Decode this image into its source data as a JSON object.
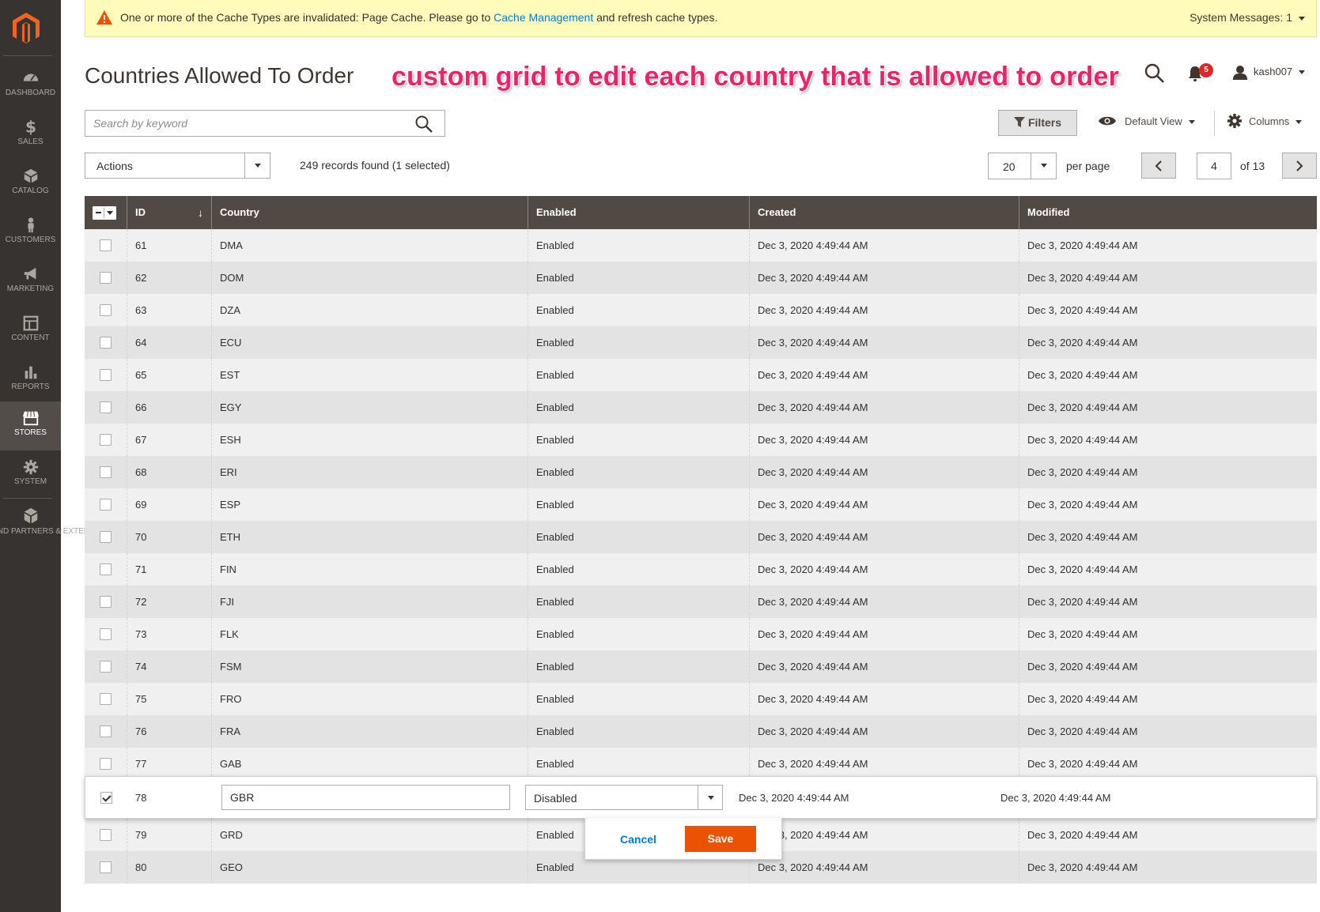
{
  "sidebar": {
    "items": [
      {
        "label": "DASHBOARD",
        "icon": "dashboard-icon"
      },
      {
        "label": "SALES",
        "icon": "dollar-icon"
      },
      {
        "label": "CATALOG",
        "icon": "cube-icon"
      },
      {
        "label": "CUSTOMERS",
        "icon": "person-icon"
      },
      {
        "label": "MARKETING",
        "icon": "megaphone-icon"
      },
      {
        "label": "CONTENT",
        "icon": "layout-icon"
      },
      {
        "label": "REPORTS",
        "icon": "bar-chart-icon"
      },
      {
        "label": "STORES",
        "icon": "storefront-icon"
      },
      {
        "label": "SYSTEM",
        "icon": "gear-icon"
      },
      {
        "label": "IND PARTNERS & EXTENSIONS",
        "icon": "blocks-icon"
      }
    ],
    "active": "STORES"
  },
  "system_message": {
    "text_before": "One or more of the Cache Types are invalidated: Page Cache. Please go to ",
    "link": "Cache Management",
    "text_after": " and refresh cache types.",
    "right_label": "System Messages: 1"
  },
  "header": {
    "title": "Countries Allowed To Order",
    "annotation": "custom grid to edit each country that is allowed to order",
    "notification_count": "5",
    "username": "kash007"
  },
  "toolbar": {
    "search_placeholder": "Search by keyword",
    "filters_label": "Filters",
    "view_label": "Default View",
    "columns_label": "Columns",
    "actions_label": "Actions",
    "records_text": "249 records found (1 selected)",
    "per_page_value": "20",
    "per_page_label": "per page",
    "current_page": "4",
    "page_total": "of 13"
  },
  "grid": {
    "columns": [
      "ID",
      "Country",
      "Enabled",
      "Created",
      "Modified"
    ],
    "rows": [
      {
        "id": "61",
        "country": "DMA",
        "enabled": "Enabled",
        "created": "Dec 3, 2020 4:49:44 AM",
        "modified": "Dec 3, 2020 4:49:44 AM"
      },
      {
        "id": "62",
        "country": "DOM",
        "enabled": "Enabled",
        "created": "Dec 3, 2020 4:49:44 AM",
        "modified": "Dec 3, 2020 4:49:44 AM"
      },
      {
        "id": "63",
        "country": "DZA",
        "enabled": "Enabled",
        "created": "Dec 3, 2020 4:49:44 AM",
        "modified": "Dec 3, 2020 4:49:44 AM"
      },
      {
        "id": "64",
        "country": "ECU",
        "enabled": "Enabled",
        "created": "Dec 3, 2020 4:49:44 AM",
        "modified": "Dec 3, 2020 4:49:44 AM"
      },
      {
        "id": "65",
        "country": "EST",
        "enabled": "Enabled",
        "created": "Dec 3, 2020 4:49:44 AM",
        "modified": "Dec 3, 2020 4:49:44 AM"
      },
      {
        "id": "66",
        "country": "EGY",
        "enabled": "Enabled",
        "created": "Dec 3, 2020 4:49:44 AM",
        "modified": "Dec 3, 2020 4:49:44 AM"
      },
      {
        "id": "67",
        "country": "ESH",
        "enabled": "Enabled",
        "created": "Dec 3, 2020 4:49:44 AM",
        "modified": "Dec 3, 2020 4:49:44 AM"
      },
      {
        "id": "68",
        "country": "ERI",
        "enabled": "Enabled",
        "created": "Dec 3, 2020 4:49:44 AM",
        "modified": "Dec 3, 2020 4:49:44 AM"
      },
      {
        "id": "69",
        "country": "ESP",
        "enabled": "Enabled",
        "created": "Dec 3, 2020 4:49:44 AM",
        "modified": "Dec 3, 2020 4:49:44 AM"
      },
      {
        "id": "70",
        "country": "ETH",
        "enabled": "Enabled",
        "created": "Dec 3, 2020 4:49:44 AM",
        "modified": "Dec 3, 2020 4:49:44 AM"
      },
      {
        "id": "71",
        "country": "FIN",
        "enabled": "Enabled",
        "created": "Dec 3, 2020 4:49:44 AM",
        "modified": "Dec 3, 2020 4:49:44 AM"
      },
      {
        "id": "72",
        "country": "FJI",
        "enabled": "Enabled",
        "created": "Dec 3, 2020 4:49:44 AM",
        "modified": "Dec 3, 2020 4:49:44 AM"
      },
      {
        "id": "73",
        "country": "FLK",
        "enabled": "Enabled",
        "created": "Dec 3, 2020 4:49:44 AM",
        "modified": "Dec 3, 2020 4:49:44 AM"
      },
      {
        "id": "74",
        "country": "FSM",
        "enabled": "Enabled",
        "created": "Dec 3, 2020 4:49:44 AM",
        "modified": "Dec 3, 2020 4:49:44 AM"
      },
      {
        "id": "75",
        "country": "FRO",
        "enabled": "Enabled",
        "created": "Dec 3, 2020 4:49:44 AM",
        "modified": "Dec 3, 2020 4:49:44 AM"
      },
      {
        "id": "76",
        "country": "FRA",
        "enabled": "Enabled",
        "created": "Dec 3, 2020 4:49:44 AM",
        "modified": "Dec 3, 2020 4:49:44 AM"
      },
      {
        "id": "77",
        "country": "GAB",
        "enabled": "Enabled",
        "created": "Dec 3, 2020 4:49:44 AM",
        "modified": "Dec 3, 2020 4:49:44 AM"
      }
    ],
    "edit_row": {
      "id": "78",
      "country": "GBR",
      "enabled": "Disabled",
      "created": "Dec 3, 2020 4:49:44 AM",
      "modified": "Dec 3, 2020 4:49:44 AM",
      "checked": true
    },
    "rows_after": [
      {
        "id": "79",
        "country": "GRD",
        "enabled": "Enabled",
        "created": "Dec 3, 2020 4:49:44 AM",
        "modified": "Dec 3, 2020 4:49:44 AM"
      },
      {
        "id": "80",
        "country": "GEO",
        "enabled": "Enabled",
        "created": "Dec 3, 2020 4:49:44 AM",
        "modified": "Dec 3, 2020 4:49:44 AM"
      }
    ],
    "cancel_label": "Cancel",
    "save_label": "Save"
  },
  "colors": {
    "sidebar_bg": "#373330",
    "header_bg": "#514943",
    "accent": "#eb5202",
    "link": "#007bdb",
    "annotation": "#e8246a"
  }
}
